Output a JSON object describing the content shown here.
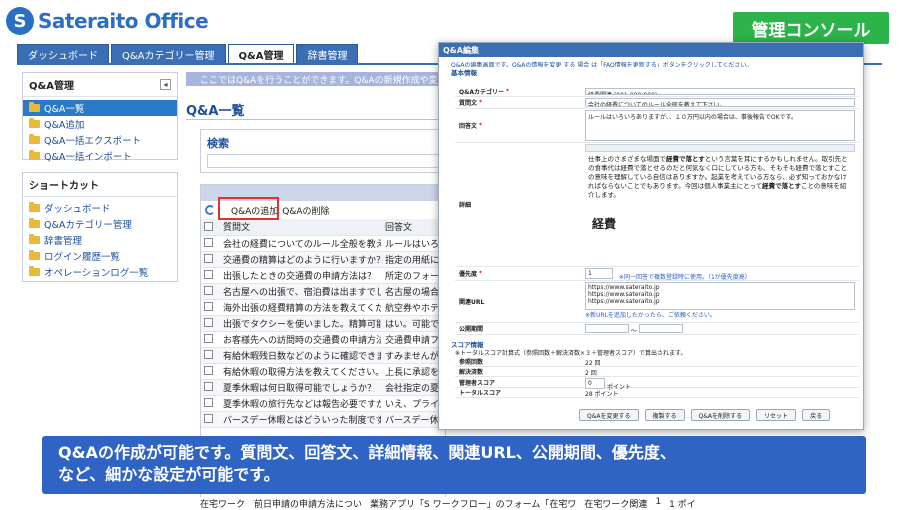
{
  "header": {
    "logo_mark": "S",
    "logo_text": "Sateraito Office",
    "console_label": "管理コンソール"
  },
  "tabs": [
    {
      "label": "ダッシュボード",
      "active": false
    },
    {
      "label": "Q&Aカテゴリー管理",
      "active": false
    },
    {
      "label": "Q&A管理",
      "active": true
    },
    {
      "label": "辞書管理",
      "active": false
    }
  ],
  "sidebar": {
    "main_title": "Q&A管理",
    "collapse_symbol": "◂",
    "main_items": [
      "Q&A一覧",
      "Q&A追加",
      "Q&A一括エクスポート",
      "Q&A一括インポート"
    ],
    "shortcut_title": "ショートカット",
    "shortcut_items": [
      "ダッシュボード",
      "Q&Aカテゴリー管理",
      "辞書管理",
      "ログイン履歴一覧",
      "オペレーションログ一覧"
    ]
  },
  "main": {
    "info_bar": "ここではQ&Aを行うことができます。Q&Aの新規作成や変更",
    "page_title": "Q&A一覧",
    "search_label": "検索",
    "toolbar": {
      "add": "Q&Aの追加",
      "delete": "Q&Aの削除"
    },
    "columns": [
      "質問文",
      "回答文"
    ],
    "rows": [
      [
        "会社の経費についてのルール全般を教え...",
        "ルールはいろい"
      ],
      [
        "交通費の精算はどのように行いますか？",
        "指定の用紙に"
      ],
      [
        "出張したときの交通費の申請方法は？",
        "所定のフォーム"
      ],
      [
        "名古屋への出張で、宿泊費は出ますでし...",
        "名古屋の場合"
      ],
      [
        "海外出張の経費精算の方法を教えてくだ...",
        "航空券やホテル"
      ],
      [
        "出張でタクシーを使いました。精算可能...",
        "はい。可能で"
      ],
      [
        "お客様先への訪問時の交通費の申請方法...",
        "交通費申請フ"
      ],
      [
        "有給休暇残日数などのように確認できま...",
        "すみませんが、"
      ],
      [
        "有給休暇の取得方法を教えてください。",
        "上長に承認を"
      ],
      [
        "夏季休暇は何日取得可能でしょうか？",
        "会社指定の夏"
      ],
      [
        "夏季休暇の旅行先などは報告必要ですか？",
        "いえ、プライベ"
      ],
      [
        "バースデー休暇とはどういった制度です...",
        "バースデー休暇"
      ]
    ]
  },
  "modal": {
    "title": "Q&A編集",
    "description": "Q&Aの編集画面です。Q&Aの情報を変更 する 場合 は「FAQ情報を更新する」ボタンをクリックしてください。",
    "basic_section": "基本情報",
    "category_label": "Q&Aカテゴリー",
    "category_value": "経費関連 (001-000-000)",
    "question_label": "質問文",
    "question_value": "会社の経費についてのルール全般を教えて下さい。",
    "answer_label": "回答文",
    "answer_value": "ルールはいろいろありますが、、１０万円以内の場合は、事後報告でOKです。",
    "detail_label": "詳細",
    "detail_text_1": "仕事上のさまざまな場面で",
    "detail_bold_1": "経費で落とす",
    "detail_text_2": "という言葉を耳にするかもしれません。取引先との食事代は経費で落とせるのだと何気なく口にしている方も、そもそも経費で落とすことの意味を理解している自信はありますか。起業を考えている方なら、必ず知っておかなければならないことでもあります。今回は個人事業主にとって",
    "detail_bold_2": "経費で落とす",
    "detail_text_3": "ことの意味を紹介します。",
    "detail_heading": "経費",
    "priority_label": "優先度",
    "priority_value": "1",
    "priority_note": "※同一回答で複数登録時に使用。（1が優先度高）",
    "url_label": "関連URL",
    "url_values": [
      "https://www.sateraito.jp",
      "https://www.sateraito.jp",
      "https://www.sateraito.jp"
    ],
    "url_note": "※新URLを追加したかったら、ご依頼ください。",
    "period_label": "公開期間",
    "period_sep": "〜",
    "score_section": "スコア情報",
    "score_note": "※トータルスコア計算式（参照回数＋解決済数×３＋管理者スコア）で算出されます。",
    "score_fields": [
      {
        "label": "参照回数",
        "value": "22 回"
      },
      {
        "label": "解決済数",
        "value": "2 回"
      },
      {
        "label": "管理者スコア",
        "value": "0",
        "unit": "ポイント"
      },
      {
        "label": "トータルスコア",
        "value": "28 ポイント"
      }
    ],
    "buttons": [
      "Q&Aを変更する",
      "複製する",
      "Q&Aを削除する",
      "リセット",
      "戻る"
    ]
  },
  "caption": {
    "line1": "Q&Aの作成が可能です。質問文、回答文、詳細情報、関連URL、公開期間、優先度、",
    "line2": "など、細かな設定が可能です。"
  },
  "bottom_row": [
    "在宅ワーク　前日申請の申請方法につい",
    "業務アプリ「S ワークフロー」のフォーム「在宅ワ",
    "在宅ワーク関連",
    "1",
    "1 ポイ"
  ]
}
